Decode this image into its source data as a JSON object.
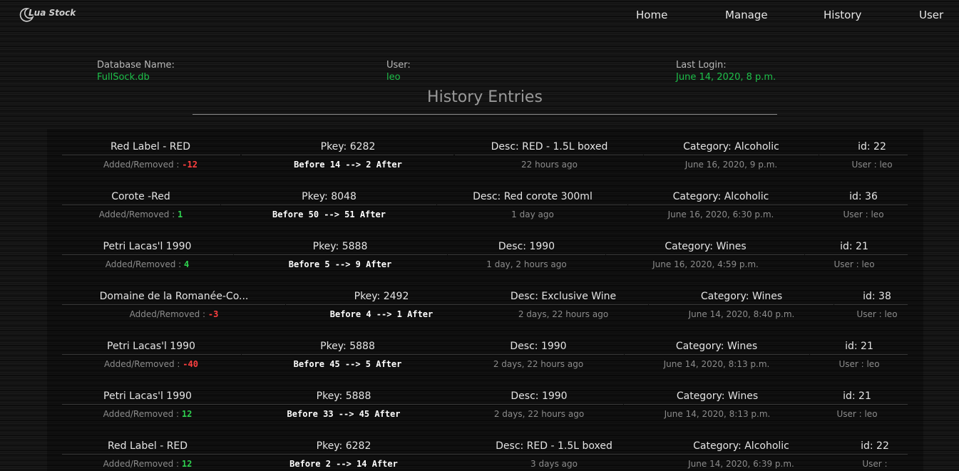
{
  "app": {
    "name": "Lua Stock"
  },
  "nav": {
    "home": "Home",
    "manage": "Manage",
    "history": "History",
    "user": "User"
  },
  "info": {
    "db_label": "Database Name:",
    "db_value": "FullSock.db",
    "user_label": "User:",
    "user_value": "leo",
    "login_label": "Last Login:",
    "login_value": "June 14, 2020, 8 p.m."
  },
  "page_title": "History Entries",
  "colors": {
    "accent_green": "#1ec04a",
    "removed_red": "#ff4040",
    "added_green": "#2fd14f"
  },
  "entries": [
    {
      "name": "Red Label - RED",
      "pkey": "Pkey: 6282",
      "desc": "Desc: RED - 1.5L boxed",
      "category": "Category: Alcoholic",
      "id": "id: 22",
      "added_label": "Added/Removed : ",
      "delta": "-12",
      "delta_sign": "neg",
      "before_after": "Before 14 --> 2 After",
      "ago": "22 hours ago",
      "date": "June 16, 2020, 9 p.m.",
      "user": "User : leo"
    },
    {
      "name": "Corote -Red",
      "pkey": "Pkey: 8048",
      "desc": "Desc: Red corote 300ml",
      "category": "Category: Alcoholic",
      "id": "id: 36",
      "added_label": "Added/Removed : ",
      "delta": "1",
      "delta_sign": "pos",
      "before_after": "Before 50 --> 51 After",
      "ago": "1 day ago",
      "date": "June 16, 2020, 6:30 p.m.",
      "user": "User : leo"
    },
    {
      "name": "Petri Lacas'l 1990",
      "pkey": "Pkey: 5888",
      "desc": "Desc: 1990",
      "category": "Category: Wines",
      "id": "id: 21",
      "added_label": "Added/Removed : ",
      "delta": "4",
      "delta_sign": "pos",
      "before_after": "Before 5 --> 9 After",
      "ago": "1 day, 2 hours ago",
      "date": "June 16, 2020, 4:59 p.m.",
      "user": "User : leo"
    },
    {
      "name": "Domaine de la Romanée-Co...",
      "pkey": "Pkey: 2492",
      "desc": "Desc: Exclusive Wine",
      "category": "Category: Wines",
      "id": "id: 38",
      "added_label": "Added/Removed : ",
      "delta": "-3",
      "delta_sign": "neg",
      "before_after": "Before 4 --> 1 After",
      "ago": "2 days, 22 hours ago",
      "date": "June 14, 2020, 8:40 p.m.",
      "user": "User : leo"
    },
    {
      "name": "Petri Lacas'l 1990",
      "pkey": "Pkey: 5888",
      "desc": "Desc: 1990",
      "category": "Category: Wines",
      "id": "id: 21",
      "added_label": "Added/Removed : ",
      "delta": "-40",
      "delta_sign": "neg",
      "before_after": "Before 45 --> 5 After",
      "ago": "2 days, 22 hours ago",
      "date": "June 14, 2020, 8:13 p.m.",
      "user": "User : leo"
    },
    {
      "name": "Petri Lacas'l 1990",
      "pkey": "Pkey: 5888",
      "desc": "Desc: 1990",
      "category": "Category: Wines",
      "id": "id: 21",
      "added_label": "Added/Removed : ",
      "delta": "12",
      "delta_sign": "pos",
      "before_after": "Before 33 --> 45 After",
      "ago": "2 days, 22 hours ago",
      "date": "June 14, 2020, 8:13 p.m.",
      "user": "User : leo"
    },
    {
      "name": "Red Label - RED",
      "pkey": "Pkey: 6282",
      "desc": "Desc: RED - 1.5L boxed",
      "category": "Category: Alcoholic",
      "id": "id: 22",
      "added_label": "Added/Removed : ",
      "delta": "12",
      "delta_sign": "pos",
      "before_after": "Before 2 --> 14 After",
      "ago": "3 days ago",
      "date": "June 14, 2020, 6:39 p.m.",
      "user": "User : "
    }
  ]
}
